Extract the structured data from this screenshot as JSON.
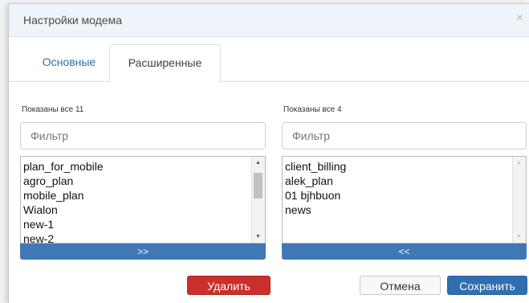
{
  "dialog": {
    "title": "Настройки модема",
    "close_icon": "close-icon"
  },
  "tabs": [
    {
      "label": "Основные",
      "active": false
    },
    {
      "label": "Расширенные",
      "active": true
    }
  ],
  "left_list": {
    "count_label": "Показаны все 11",
    "filter_placeholder": "Фильтр",
    "items": [
      "plan_for_mobile",
      "agro_plan",
      "mobile_plan",
      "Wialon",
      "new-1",
      "new-2"
    ],
    "move_label": ">>"
  },
  "right_list": {
    "count_label": "Показаны все 4",
    "filter_placeholder": "Фильтр",
    "items": [
      "client_billing",
      "alek_plan",
      "01 bjhbuon",
      "news"
    ],
    "move_label": "<<"
  },
  "buttons": {
    "delete": "Удалить",
    "cancel": "Отмена",
    "save": "Сохранить"
  },
  "colors": {
    "header_bg": "#eef4fa",
    "accent": "#3f78b5",
    "danger": "#c9302c",
    "tab_link": "#2f6fa8"
  }
}
